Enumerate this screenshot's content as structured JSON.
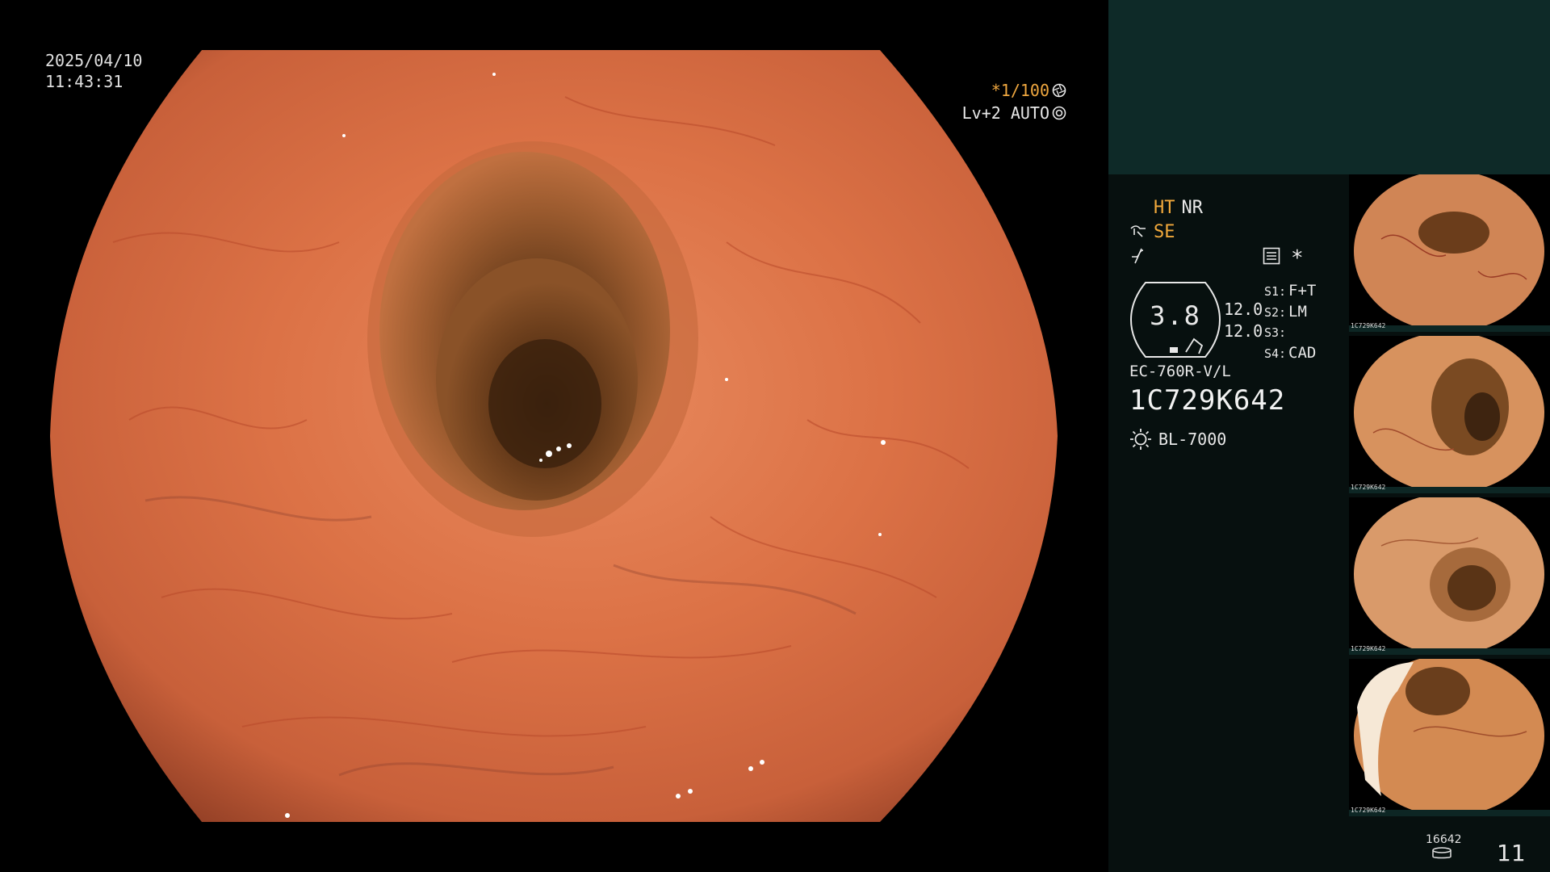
{
  "overlay": {
    "date": "2025/04/10",
    "time": "11:43:31",
    "shutter_speed": "*1/100",
    "level_mode": "Lv+2 AUTO"
  },
  "panel": {
    "modes": {
      "ht": "HT",
      "nr": "NR",
      "se": "SE"
    },
    "gauge": {
      "value": "3.8",
      "upper": "12.0",
      "lower": "12.0"
    },
    "star": "*",
    "slots": [
      {
        "key": "S1:",
        "value": "F+T"
      },
      {
        "key": "S2:",
        "value": "LM"
      },
      {
        "key": "S3:",
        "value": ""
      },
      {
        "key": "S4:",
        "value": "CAD"
      }
    ],
    "scope_model": "EC-760R-V/L",
    "serial": "1C729K642",
    "light_source": "BL-7000"
  },
  "thumbnails": [
    {
      "caption": "1C729K642"
    },
    {
      "caption": "1C729K642"
    },
    {
      "caption": "1C729K642"
    },
    {
      "caption": "1C729K642"
    }
  ],
  "footer": {
    "counter": "16642",
    "page": "11"
  },
  "colors": {
    "accent_amber": "#f2a93b",
    "panel_top": "#0e2a28",
    "panel_bg": "#07100f",
    "tissue": "#d7693f"
  }
}
